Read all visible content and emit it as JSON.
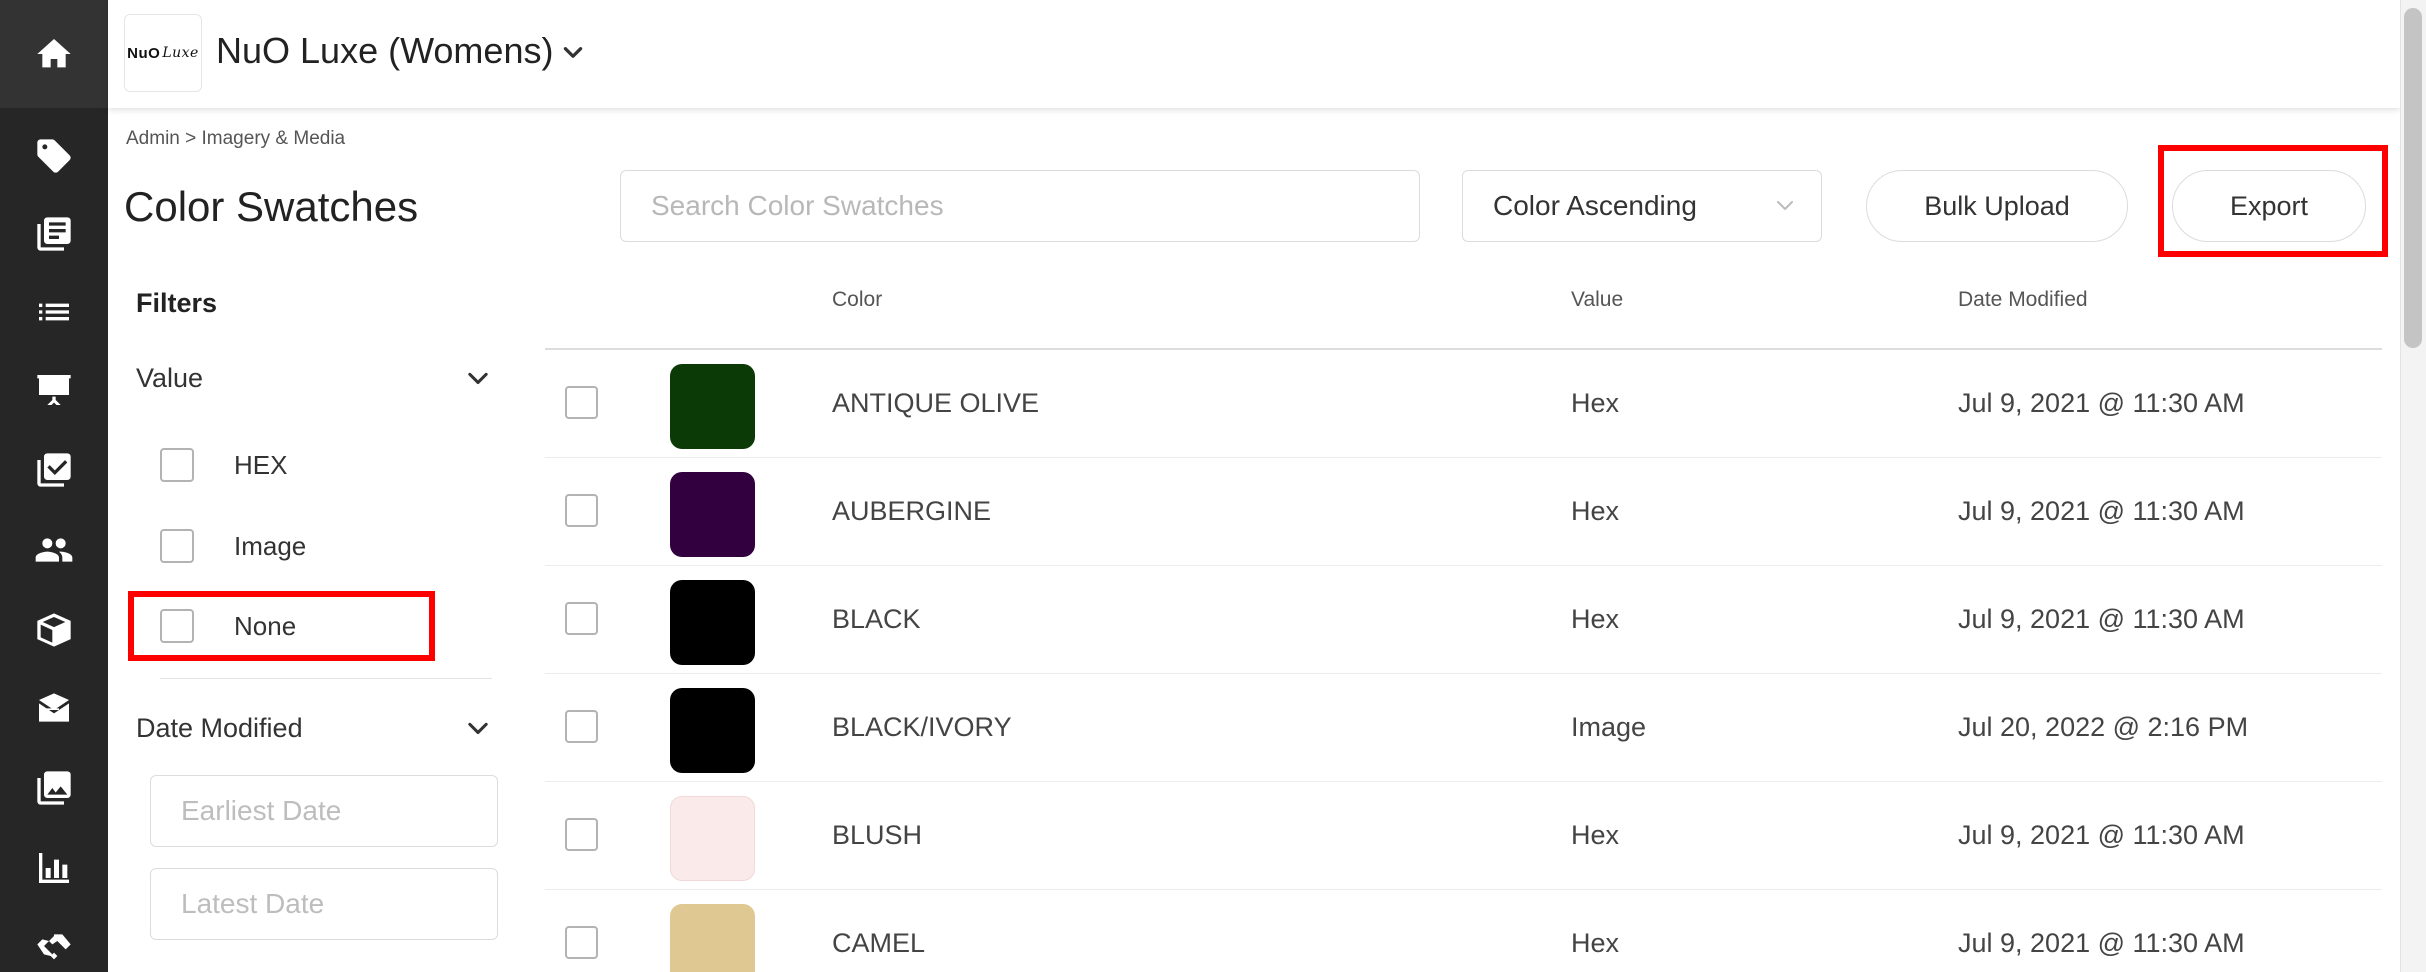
{
  "header": {
    "logo_text": "NuO",
    "logo_script": "Luxe",
    "brand_name": "NuO Luxe (Womens)"
  },
  "breadcrumb": "Admin > Imagery & Media",
  "page_title": "Color Swatches",
  "search": {
    "placeholder": "Search Color Swatches",
    "value": ""
  },
  "sort": {
    "selected": "Color Ascending"
  },
  "buttons": {
    "bulk_upload": "Bulk Upload",
    "export": "Export"
  },
  "filters": {
    "title": "Filters",
    "value_section": {
      "label": "Value",
      "options": [
        {
          "label": "HEX",
          "checked": false
        },
        {
          "label": "Image",
          "checked": false
        },
        {
          "label": "None",
          "checked": false
        }
      ]
    },
    "date_section": {
      "label": "Date Modified",
      "earliest_placeholder": "Earliest Date",
      "latest_placeholder": "Latest Date"
    }
  },
  "table": {
    "columns": {
      "color": "Color",
      "value": "Value",
      "date_modified": "Date Modified"
    },
    "rows": [
      {
        "name": "ANTIQUE OLIVE",
        "value": "Hex",
        "date": "Jul 9, 2021 @ 11:30 AM",
        "swatch": "#0b3a06"
      },
      {
        "name": "AUBERGINE",
        "value": "Hex",
        "date": "Jul 9, 2021 @ 11:30 AM",
        "swatch": "#33003f"
      },
      {
        "name": "BLACK",
        "value": "Hex",
        "date": "Jul 9, 2021 @ 11:30 AM",
        "swatch": "#000000"
      },
      {
        "name": "BLACK/IVORY",
        "value": "Image",
        "date": "Jul 20, 2022 @ 2:16 PM",
        "swatch": "#000000"
      },
      {
        "name": "BLUSH",
        "value": "Hex",
        "date": "Jul 9, 2021 @ 11:30 AM",
        "swatch": "#fbeaea"
      },
      {
        "name": "CAMEL",
        "value": "Hex",
        "date": "Jul 9, 2021 @ 11:30 AM",
        "swatch": "#dfc892"
      }
    ]
  },
  "nav_icons": [
    "home-icon",
    "tag-icon",
    "catalog-icon",
    "list-icon",
    "presentation-icon",
    "checklist-icon",
    "users-icon",
    "box-icon",
    "mail-icon",
    "image-icon",
    "bar-chart-icon",
    "handshake-icon"
  ],
  "colors": {
    "nav_bg": "#262626",
    "highlight": "#ff0000"
  }
}
